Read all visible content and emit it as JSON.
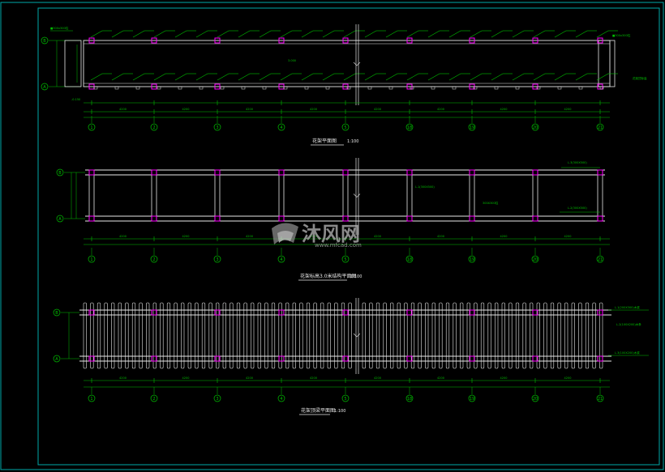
{
  "colors": {
    "background": "#000000",
    "frame": "#00a8a8",
    "structure": "#e8e8e8",
    "dimension": "#00c000",
    "column": "#ff00ff",
    "annotation": "#00c000",
    "title": "#e8e8e8",
    "watermark": "#c8c8c8"
  },
  "plan1": {
    "title": "花架平面图",
    "scale": "1:100",
    "axis_rows": [
      "B",
      "A"
    ],
    "axis_cols": [
      "1",
      "2",
      "3",
      "4",
      "5",
      "18",
      "19",
      "20",
      "21"
    ],
    "note_left_top": "■300x300柱",
    "note_right_top": "■300x300柱",
    "note_right_bot": "花架顶标高",
    "note_center": "3.000",
    "note_elev": "-0.150"
  },
  "plan2": {
    "title": "花架标高3.0米结构平面图",
    "scale": "1:100",
    "axis_rows": [
      "B",
      "A"
    ],
    "axis_cols": [
      "1",
      "2",
      "3",
      "4",
      "5",
      "18",
      "19",
      "20",
      "21"
    ],
    "note_top_right": "L.3(300X500)",
    "note_mid": "L.1(300X500)",
    "note_mid2": "300X300柱",
    "note_bot_right": "L.2(300X500)"
  },
  "plan3": {
    "title": "花架顶梁平面图",
    "scale": "1:100",
    "axis_rows": [
      "B",
      "A"
    ],
    "axis_cols": [
      "1",
      "2",
      "3",
      "4",
      "5",
      "18",
      "19",
      "20",
      "21"
    ],
    "note_top_right": "L.1(200X300)木梁",
    "note_mid_right": "L.2(100X200)木条",
    "note_bot_right": "L.3(100X200)木梁"
  },
  "dims": {
    "bay": "4200",
    "span": "3000"
  },
  "watermark": {
    "text": "沐风网",
    "url": "www.mfcad.com"
  }
}
